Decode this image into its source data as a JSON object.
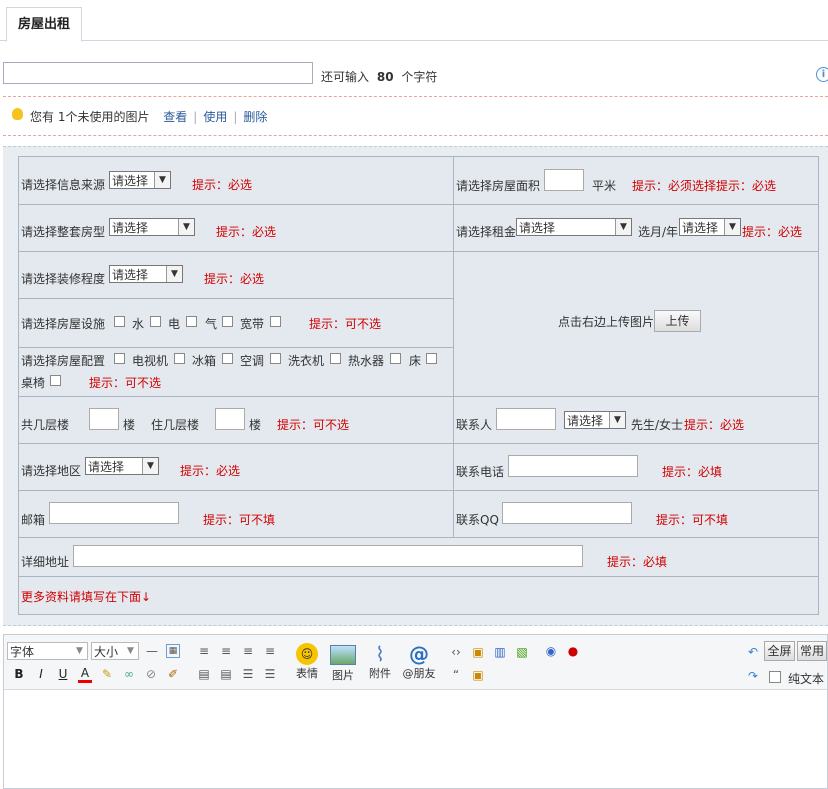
{
  "tab": {
    "label": "房屋出租"
  },
  "title_field": {
    "value": "",
    "remaining_prefix": "还可输入",
    "remaining_count": "80",
    "remaining_suffix": "个字符"
  },
  "attachment": {
    "text": "您有  1个未使用的图片",
    "view": "查看",
    "use": "使用",
    "delete": "删除"
  },
  "form": {
    "source": {
      "label": "请选择信息来源",
      "select": "请选择",
      "hint": "提示：必选"
    },
    "area": {
      "label": "请选择房屋面积",
      "unit": "平米",
      "hint": "提示：必须选择提示：必选"
    },
    "layout": {
      "label": "请选择整套房型",
      "select": "请选择",
      "hint": "提示：必选"
    },
    "rent": {
      "label": "请选择租金",
      "select": "请选择",
      "period_label": "选月/年",
      "period_select": "请选择",
      "hint": "提示：必选"
    },
    "decoration": {
      "label": "请选择装修程度",
      "select": "请选择",
      "hint": "提示：必选"
    },
    "facilities": {
      "label": "请选择房屋设施",
      "items": [
        "水",
        "电",
        "气",
        "宽带"
      ],
      "hint": "提示：可不选"
    },
    "upload": {
      "text": "点击右边上传图片",
      "button": "上传"
    },
    "appliances": {
      "label": "请选择房屋配置",
      "items": [
        "电视机",
        "冰箱",
        "空调",
        "洗衣机",
        "热水器",
        "床"
      ],
      "items2": [
        "桌椅"
      ],
      "hint": "提示：可不选"
    },
    "floors": {
      "total_label": "共几层楼",
      "floor_unit": "楼",
      "live_label": "住几层楼",
      "live_unit": "楼",
      "hint": "提示：可不选"
    },
    "contact": {
      "label": "联系人",
      "select": "请选择",
      "suffix": "先生/女士",
      "hint": "提示：必选"
    },
    "region": {
      "label": "请选择地区",
      "select": "请选择",
      "hint": "提示：必选"
    },
    "phone": {
      "label": "联系电话",
      "hint": "提示：必填"
    },
    "email": {
      "label": "邮箱",
      "hint": "提示：可不填"
    },
    "qq": {
      "label": "联系QQ",
      "hint": "提示：可不填"
    },
    "address": {
      "label": "详细地址",
      "hint": "提示：必填"
    },
    "more": {
      "text": "更多资料请填写在下面↓"
    }
  },
  "editor": {
    "font_select": "字体",
    "size_select": "大小",
    "emoji": "表情",
    "image": "图片",
    "attach": "附件",
    "mention": "@朋友",
    "fullscreen": "全屏",
    "common": "常用",
    "plain_text": "纯文本"
  }
}
